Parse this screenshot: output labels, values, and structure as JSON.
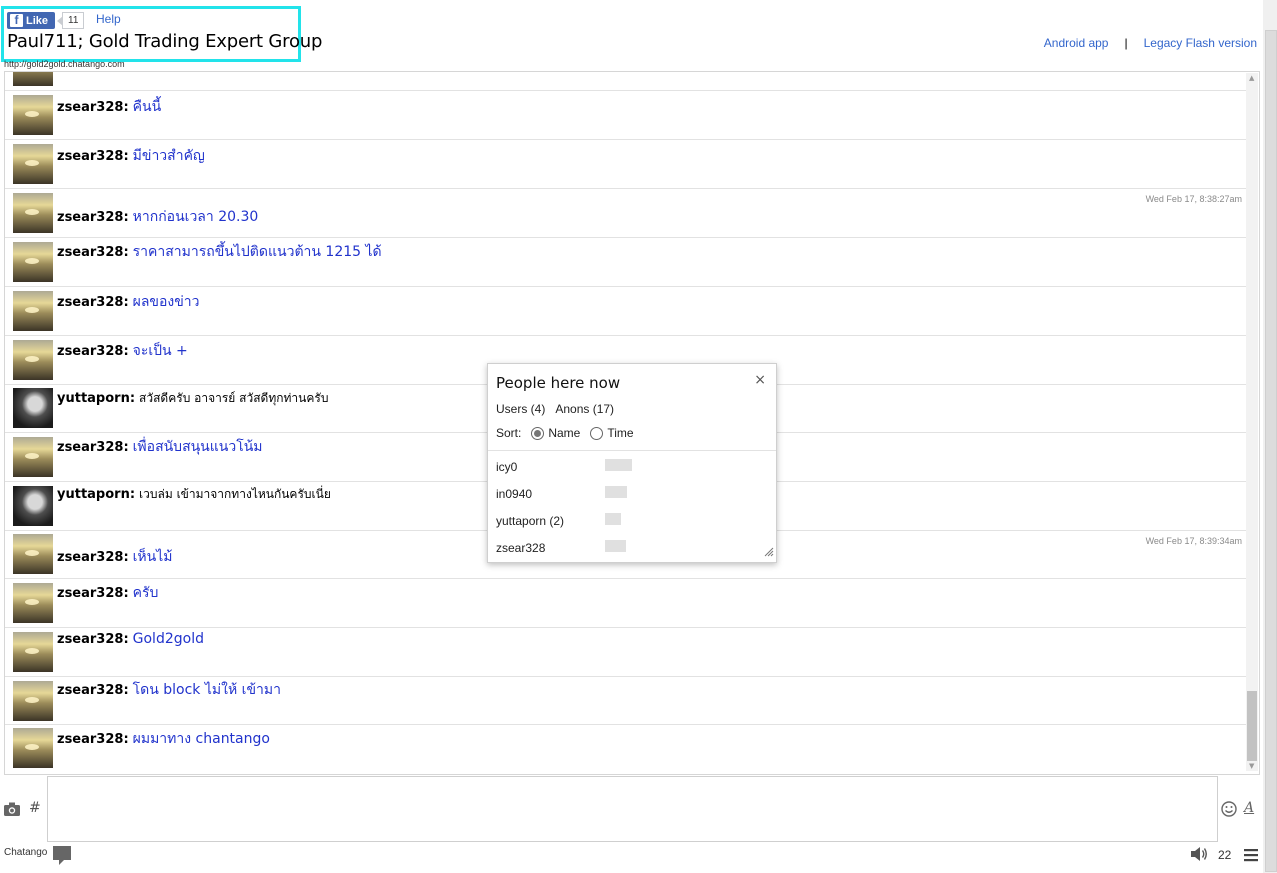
{
  "header": {
    "fb_like_label": "Like",
    "fb_like_count": "11",
    "help_label": "Help",
    "room_title": "Paul711; Gold Trading Expert Group",
    "room_url": "http://gold2gold.chatango.com",
    "android_link": "Android app",
    "separator": "|",
    "flash_link": "Legacy Flash version"
  },
  "messages": [
    {
      "user": "zsear328:",
      "text": "คืนนี้",
      "timestamp": "",
      "avatar": "sunset"
    },
    {
      "user": "zsear328:",
      "text": "มีข่าวสำคัญ",
      "timestamp": "",
      "avatar": "sunset"
    },
    {
      "user": "zsear328:",
      "text": "หากก่อนเวลา 20.30",
      "timestamp": "Wed Feb 17, 8:38:27am",
      "avatar": "sunset"
    },
    {
      "user": "zsear328:",
      "text": "ราคาสามารถขึ้นไปติดแนวต้าน 1215 ได้",
      "timestamp": "",
      "avatar": "sunset"
    },
    {
      "user": "zsear328:",
      "text": "ผลของข่าว",
      "timestamp": "",
      "avatar": "sunset"
    },
    {
      "user": "zsear328:",
      "text": "จะเป็น +",
      "timestamp": "",
      "avatar": "sunset"
    },
    {
      "user": "yuttaporn:",
      "text": "สวัสดีครับ อาจารย์ สวัสดีทุกท่านครับ",
      "timestamp": "",
      "avatar": "portrait"
    },
    {
      "user": "zsear328:",
      "text": "เพื่อสนับสนุนแนวโน้ม",
      "timestamp": "",
      "avatar": "sunset"
    },
    {
      "user": "yuttaporn:",
      "text": "เวบล่ม เข้ามาจากทางไหนกันครับเนี่ย",
      "timestamp": "",
      "avatar": "portrait"
    },
    {
      "user": "zsear328:",
      "text": "เห็นไม้",
      "timestamp": "Wed Feb 17, 8:39:34am",
      "avatar": "sunset"
    },
    {
      "user": "zsear328:",
      "text": "ครับ",
      "timestamp": "",
      "avatar": "sunset"
    },
    {
      "user": "zsear328:",
      "text": "Gold2gold",
      "timestamp": "",
      "avatar": "sunset"
    },
    {
      "user": "zsear328:",
      "text": "โดน block ไม่ให้ เข้ามา",
      "timestamp": "",
      "avatar": "sunset"
    },
    {
      "user": "zsear328:",
      "text": "ผมมาทาง chantango",
      "timestamp": "",
      "avatar": "sunset"
    }
  ],
  "popup": {
    "title": "People here now",
    "close_glyph": "×",
    "users_label": "Users (4)",
    "anons_label": "Anons (17)",
    "sort_label": "Sort:",
    "sort_name": "Name",
    "sort_time": "Time",
    "sort_selected": "Name",
    "users": [
      {
        "name": "icy0"
      },
      {
        "name": "in0940"
      },
      {
        "name": "yuttaporn (2)"
      },
      {
        "name": "zsear328"
      }
    ]
  },
  "input": {
    "hash_label": "#",
    "font_label": "A"
  },
  "footer": {
    "brand": "Chatango",
    "volume": "22"
  },
  "colors": {
    "accent_border": "#22e3ea",
    "link": "#3366cc",
    "message_text": "#2133cc",
    "facebook": "#4267b2"
  },
  "icons": [
    "camera-icon",
    "smile-icon",
    "speaker-icon",
    "menu-icon",
    "chat-bubble-icon",
    "facebook-icon"
  ]
}
